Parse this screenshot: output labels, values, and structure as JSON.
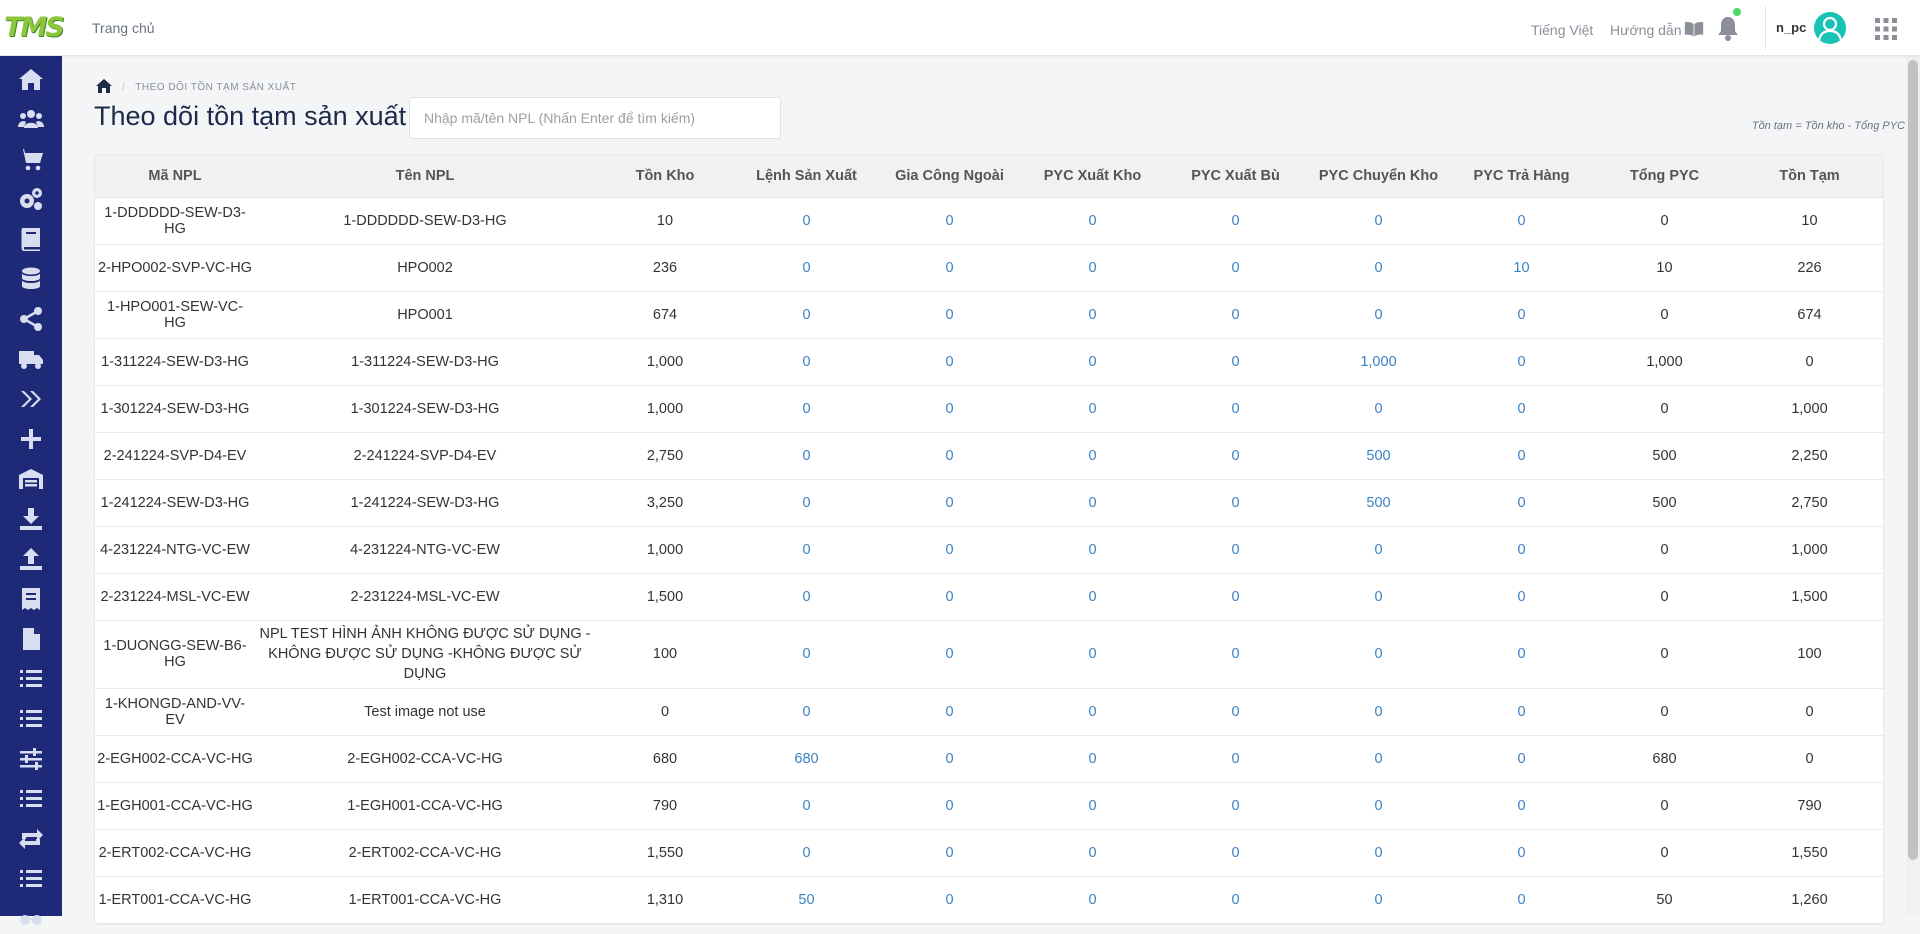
{
  "header": {
    "logo_text": "TMS",
    "nav_home": "Trang chủ",
    "language": "Tiếng Việt",
    "guide": "Hướng dẫn",
    "username": "n_pc",
    "notification_dot_color": "#4cd964",
    "icons": [
      "book-icon",
      "bell-icon",
      "avatar-icon",
      "apps-grid-icon"
    ]
  },
  "sidebar": {
    "icons": [
      "home-icon",
      "users-icon",
      "cart-icon",
      "settings-icon",
      "book-icon",
      "database-icon",
      "share-icon",
      "truck-icon",
      "double-chevron-icon",
      "plus-icon",
      "warehouse-icon",
      "download-icon",
      "upload-icon",
      "receipt-icon",
      "file-icon",
      "list-icon",
      "list-icon",
      "sliders-icon",
      "list-icon",
      "repeat-icon",
      "list-icon",
      "glasses-icon"
    ]
  },
  "breadcrumb": {
    "current": "THEO DÕI TỒN TẠM SẢN XUẤT"
  },
  "page": {
    "title": "Theo dõi tồn tạm sản xuất",
    "search_placeholder": "Nhập mã/tên NPL (Nhấn Enter để tìm kiếm)",
    "formula": "Tồn tạm = Tồn kho - Tổng PYC"
  },
  "table": {
    "columns": [
      "Mã NPL",
      "Tên NPL",
      "Tồn Kho",
      "Lệnh Sản Xuất",
      "Gia Công Ngoài",
      "PYC Xuất Kho",
      "PYC Xuất Bù",
      "PYC Chuyển Kho",
      "PYC Trả Hàng",
      "Tổng PYC",
      "Tồn Tạm"
    ],
    "rows": [
      {
        "code": "1-DDDDDD-SEW-D3-HG",
        "name": "1-DDDDDD-SEW-D3-HG",
        "ton_kho": "10",
        "lenh_sx": "0",
        "gia_cong": "0",
        "pyc_xuat_kho": "0",
        "pyc_xuat_bu": "0",
        "pyc_chuyen_kho": "0",
        "pyc_tra_hang": "0",
        "tong_pyc": "0",
        "ton_tam": "10"
      },
      {
        "code": "2-HPO002-SVP-VC-HG",
        "name": "HPO002",
        "ton_kho": "236",
        "lenh_sx": "0",
        "gia_cong": "0",
        "pyc_xuat_kho": "0",
        "pyc_xuat_bu": "0",
        "pyc_chuyen_kho": "0",
        "pyc_tra_hang": "10",
        "tong_pyc": "10",
        "ton_tam": "226"
      },
      {
        "code": "1-HPO001-SEW-VC-HG",
        "name": "HPO001",
        "ton_kho": "674",
        "lenh_sx": "0",
        "gia_cong": "0",
        "pyc_xuat_kho": "0",
        "pyc_xuat_bu": "0",
        "pyc_chuyen_kho": "0",
        "pyc_tra_hang": "0",
        "tong_pyc": "0",
        "ton_tam": "674"
      },
      {
        "code": "1-311224-SEW-D3-HG",
        "name": "1-311224-SEW-D3-HG",
        "ton_kho": "1,000",
        "lenh_sx": "0",
        "gia_cong": "0",
        "pyc_xuat_kho": "0",
        "pyc_xuat_bu": "0",
        "pyc_chuyen_kho": "1,000",
        "pyc_tra_hang": "0",
        "tong_pyc": "1,000",
        "ton_tam": "0"
      },
      {
        "code": "1-301224-SEW-D3-HG",
        "name": "1-301224-SEW-D3-HG",
        "ton_kho": "1,000",
        "lenh_sx": "0",
        "gia_cong": "0",
        "pyc_xuat_kho": "0",
        "pyc_xuat_bu": "0",
        "pyc_chuyen_kho": "0",
        "pyc_tra_hang": "0",
        "tong_pyc": "0",
        "ton_tam": "1,000"
      },
      {
        "code": "2-241224-SVP-D4-EV",
        "name": "2-241224-SVP-D4-EV",
        "ton_kho": "2,750",
        "lenh_sx": "0",
        "gia_cong": "0",
        "pyc_xuat_kho": "0",
        "pyc_xuat_bu": "0",
        "pyc_chuyen_kho": "500",
        "pyc_tra_hang": "0",
        "tong_pyc": "500",
        "ton_tam": "2,250"
      },
      {
        "code": "1-241224-SEW-D3-HG",
        "name": "1-241224-SEW-D3-HG",
        "ton_kho": "3,250",
        "lenh_sx": "0",
        "gia_cong": "0",
        "pyc_xuat_kho": "0",
        "pyc_xuat_bu": "0",
        "pyc_chuyen_kho": "500",
        "pyc_tra_hang": "0",
        "tong_pyc": "500",
        "ton_tam": "2,750"
      },
      {
        "code": "4-231224-NTG-VC-EW",
        "name": "4-231224-NTG-VC-EW",
        "ton_kho": "1,000",
        "lenh_sx": "0",
        "gia_cong": "0",
        "pyc_xuat_kho": "0",
        "pyc_xuat_bu": "0",
        "pyc_chuyen_kho": "0",
        "pyc_tra_hang": "0",
        "tong_pyc": "0",
        "ton_tam": "1,000"
      },
      {
        "code": "2-231224-MSL-VC-EW",
        "name": "2-231224-MSL-VC-EW",
        "ton_kho": "1,500",
        "lenh_sx": "0",
        "gia_cong": "0",
        "pyc_xuat_kho": "0",
        "pyc_xuat_bu": "0",
        "pyc_chuyen_kho": "0",
        "pyc_tra_hang": "0",
        "tong_pyc": "0",
        "ton_tam": "1,500"
      },
      {
        "code": "1-DUONGG-SEW-B6-HG",
        "name": "NPL TEST HÌNH ẢNH KHÔNG ĐƯỢC SỬ DỤNG - KHÔNG ĐƯỢC SỬ DỤNG -KHÔNG ĐƯỢC SỬ DỤNG",
        "ton_kho": "100",
        "lenh_sx": "0",
        "gia_cong": "0",
        "pyc_xuat_kho": "0",
        "pyc_xuat_bu": "0",
        "pyc_chuyen_kho": "0",
        "pyc_tra_hang": "0",
        "tong_pyc": "0",
        "ton_tam": "100"
      },
      {
        "code": "1-KHONGD-AND-VV-EV",
        "name": "Test image not use",
        "ton_kho": "0",
        "lenh_sx": "0",
        "gia_cong": "0",
        "pyc_xuat_kho": "0",
        "pyc_xuat_bu": "0",
        "pyc_chuyen_kho": "0",
        "pyc_tra_hang": "0",
        "tong_pyc": "0",
        "ton_tam": "0"
      },
      {
        "code": "2-EGH002-CCA-VC-HG",
        "name": "2-EGH002-CCA-VC-HG",
        "ton_kho": "680",
        "lenh_sx": "680",
        "gia_cong": "0",
        "pyc_xuat_kho": "0",
        "pyc_xuat_bu": "0",
        "pyc_chuyen_kho": "0",
        "pyc_tra_hang": "0",
        "tong_pyc": "680",
        "ton_tam": "0"
      },
      {
        "code": "1-EGH001-CCA-VC-HG",
        "name": "1-EGH001-CCA-VC-HG",
        "ton_kho": "790",
        "lenh_sx": "0",
        "gia_cong": "0",
        "pyc_xuat_kho": "0",
        "pyc_xuat_bu": "0",
        "pyc_chuyen_kho": "0",
        "pyc_tra_hang": "0",
        "tong_pyc": "0",
        "ton_tam": "790"
      },
      {
        "code": "2-ERT002-CCA-VC-HG",
        "name": "2-ERT002-CCA-VC-HG",
        "ton_kho": "1,550",
        "lenh_sx": "0",
        "gia_cong": "0",
        "pyc_xuat_kho": "0",
        "pyc_xuat_bu": "0",
        "pyc_chuyen_kho": "0",
        "pyc_tra_hang": "0",
        "tong_pyc": "0",
        "ton_tam": "1,550"
      },
      {
        "code": "1-ERT001-CCA-VC-HG",
        "name": "1-ERT001-CCA-VC-HG",
        "ton_kho": "1,310",
        "lenh_sx": "50",
        "gia_cong": "0",
        "pyc_xuat_kho": "0",
        "pyc_xuat_bu": "0",
        "pyc_chuyen_kho": "0",
        "pyc_tra_hang": "0",
        "tong_pyc": "50",
        "ton_tam": "1,260"
      }
    ]
  },
  "colors": {
    "sidebar_bg": "#1e2a78",
    "link_blue": "#3b82c4",
    "logo_green": "#8cc63f",
    "avatar_teal": "#17c2b6"
  }
}
